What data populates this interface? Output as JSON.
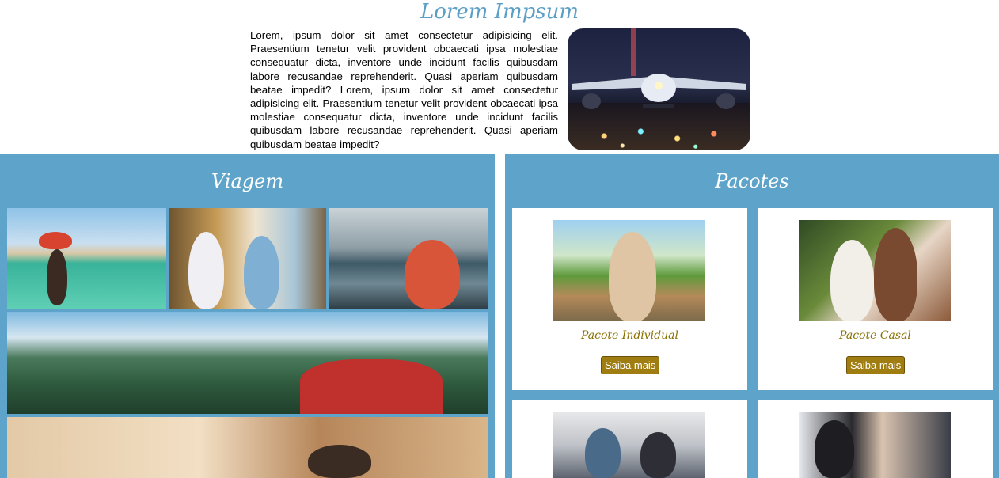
{
  "header": {
    "title": "Lorem Impsum",
    "intro_text": "Lorem, ipsum dolor sit amet consectetur adipisicing elit. Praesentium tenetur velit provident obcaecati ipsa molestiae consequatur dicta, inventore unde incidunt facilis quibusdam labore recusandae reprehenderit. Quasi aperiam quibusdam beatae impedit? Lorem, ipsum dolor sit amet consectetur adipisicing elit. Praesentium tenetur velit provident obcaecati ipsa molestiae consequatur dicta, inventore unde incidunt facilis quibusdam labore recusandae reprehenderit. Quasi aperiam quibusdam beatae impedit?"
  },
  "viagem": {
    "title": "Viagem"
  },
  "pacotes": {
    "title": "Pacotes",
    "cards": [
      {
        "label": "Pacote Individual",
        "button": "Saiba mais"
      },
      {
        "label": "Pacote Casal",
        "button": "Saiba mais"
      },
      {
        "label": "",
        "button": ""
      },
      {
        "label": "",
        "button": ""
      }
    ]
  },
  "colors": {
    "accent": "#5ea3c9",
    "title": "#5b9ec6",
    "card_label": "#8a7000",
    "button": "#a07d10"
  }
}
